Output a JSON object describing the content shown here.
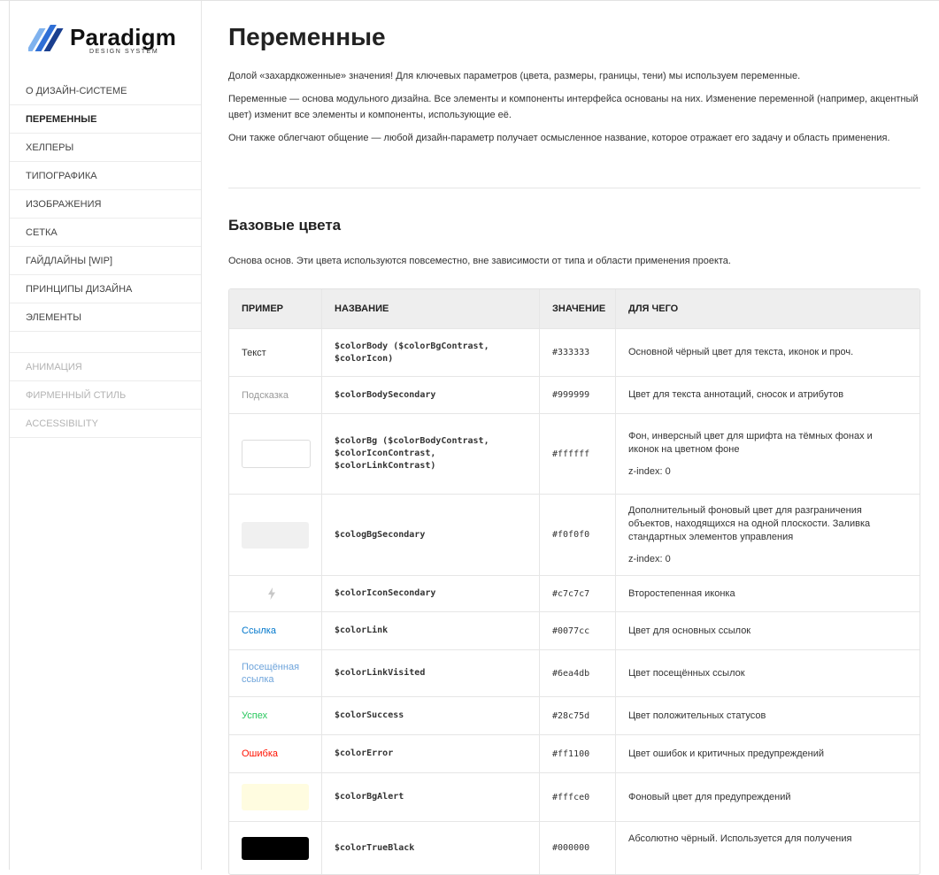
{
  "brand": {
    "name": "Paradigm",
    "tagline": "DESIGN SYSTEM",
    "colors": {
      "logo_blue": "#2f6fd6",
      "logo_light": "#7fb2ee",
      "logo_dark": "#1a3f8f"
    }
  },
  "sidebar": {
    "primary": [
      {
        "label": "О дизайн-системе"
      },
      {
        "label": "Переменные"
      },
      {
        "label": "Хелперы"
      },
      {
        "label": "Типографика"
      },
      {
        "label": "Изображения"
      },
      {
        "label": "Сетка"
      },
      {
        "label": "Гайдлайны [WIP]"
      },
      {
        "label": "Принципы дизайна"
      },
      {
        "label": "Элементы"
      }
    ],
    "active_index": 1,
    "secondary": [
      {
        "label": "Анимация"
      },
      {
        "label": "Фирменный стиль"
      },
      {
        "label": "Accessibility"
      }
    ]
  },
  "page": {
    "title": "Переменные",
    "intro": [
      "Долой «захардкоженные» значения! Для ключевых параметров (цвета, размеры, границы, тени) мы используем переменные.",
      "Переменные — основа модульного дизайна. Все элементы и компоненты интерфейса основаны на них. Изменение переменной (например, акцентный цвет) изменит все элементы и компоненты, использующие её.",
      "Они также облегчают общение — любой дизайн-параметр получает осмысленное название, которое отражает его задачу и область применения."
    ],
    "section_title": "Базовые цвета",
    "section_sub": "Основа основ. Эти цвета используются повсеместно, вне зависимости от типа и области применения проекта."
  },
  "table": {
    "headers": {
      "example": "Пример",
      "name": "Название",
      "value": "Значение",
      "purpose": "Для чего"
    },
    "rows": [
      {
        "example_text": "Текст",
        "example_color": "#333333",
        "name": "$colorBody ($colorBgContrast, $colorIcon)",
        "value": "#333333",
        "purpose": "Основной чёрный цвет для текста, иконок и проч."
      },
      {
        "example_text": "Подсказка",
        "example_color": "#999999",
        "name": "$colorBodySecondary",
        "value": "#999999",
        "purpose": "Цвет для текста аннотаций, сносок и атрибутов"
      },
      {
        "swatch": "#ffffff",
        "swatch_border": "#dddddd",
        "name": "$colorBg ($colorBodyContrast, $colorIconContrast, $colorLinkContrast)",
        "value": "#ffffff",
        "purpose": "Фон, инверсный цвет для шрифта на тёмных фонах и иконок на цветном фоне",
        "note": "z-index: 0"
      },
      {
        "swatch": "#f0f0f0",
        "name": "$cologBgSecondary",
        "value": "#f0f0f0",
        "purpose": "Дополнительный фоновый цвет для разграничения объектов, находящихся на одной плоскости. Заливка стандартных элементов управления",
        "note": "z-index: 0"
      },
      {
        "icon": "lightning-icon",
        "icon_color": "#c7c7c7",
        "name": "$colorIconSecondary",
        "value": "#c7c7c7",
        "purpose": "Второстепенная иконка"
      },
      {
        "example_text": "Ссылка",
        "example_color": "#0077cc",
        "name": "$colorLink",
        "value": "#0077cc",
        "purpose": "Цвет для основных ссылок"
      },
      {
        "example_text": "Посещённая ссылка",
        "example_color": "#6ea4db",
        "name": "$colorLinkVisited",
        "value": "#6ea4db",
        "purpose": "Цвет посещённых ссылок"
      },
      {
        "example_text": "Успех",
        "example_color": "#28c75d",
        "name": "$colorSuccess",
        "value": "#28c75d",
        "purpose": "Цвет положительных статусов"
      },
      {
        "example_text": "Ошибка",
        "example_color": "#ff1100",
        "name": "$colorError",
        "value": "#ff1100",
        "purpose": "Цвет ошибок и критичных предупреждений"
      },
      {
        "swatch": "#fffce0",
        "name": "$colorBgAlert",
        "value": "#fffce0",
        "purpose": "Фоновый цвет для предупреждений"
      },
      {
        "swatch": "#000000",
        "name": "$colorTrueBlack",
        "value": "#000000",
        "purpose": "Абсолютно чёрный. Используется для получения"
      }
    ]
  }
}
